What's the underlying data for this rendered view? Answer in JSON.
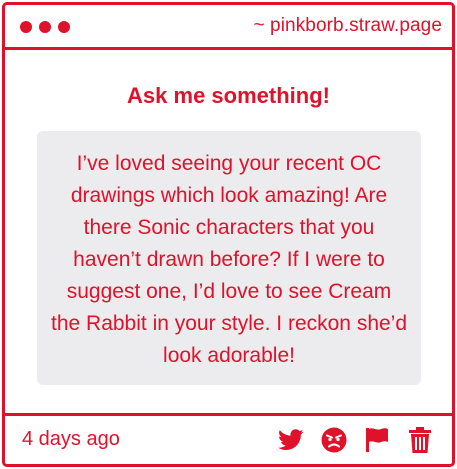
{
  "header": {
    "site_url": "~ pinkborb.straw.page"
  },
  "main": {
    "heading": "Ask me something!",
    "message": "I’ve loved seeing your recent OC drawings which look amazing! Are there Sonic characters that you haven’t drawn before? If I were to suggest one, I’d love to see Cream the Rabbit in your style. I reckon she’d look adorable!"
  },
  "footer": {
    "timestamp": "4 days ago",
    "actions": [
      "twitter-icon",
      "angry-face-icon",
      "flag-icon",
      "trash-icon"
    ]
  },
  "colors": {
    "accent": "#e0112b",
    "message_bg": "#ecebee",
    "background": "#ffffff"
  }
}
